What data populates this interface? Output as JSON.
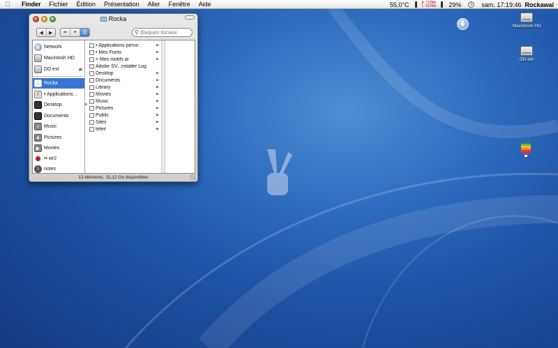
{
  "menubar": {
    "app": "Finder",
    "items": [
      "Fichier",
      "Édition",
      "Présentation",
      "Aller",
      "Fenêtre",
      "Aide"
    ],
    "temperature": "55,0°C",
    "memory_labels": [
      "8: 712Mo",
      "L: 312Mo"
    ],
    "battery": "29%",
    "clock": "sam. 17:19:46",
    "user": "Rockawai"
  },
  "window": {
    "title": "Rocka",
    "search_placeholder": "disques locaux",
    "status": "13 éléments, 15,12 Go disponibles"
  },
  "sidebar": {
    "devices": [
      {
        "label": "Network",
        "icon": "network-icon"
      },
      {
        "label": "Macintosh HD",
        "icon": "hard-disk-icon"
      },
      {
        "label": "DD ext",
        "icon": "external-disk-icon"
      }
    ],
    "places": [
      {
        "label": "Rocka",
        "icon": "home-icon",
        "selected": true
      },
      {
        "label": "• Applications…",
        "icon": "applications-icon"
      },
      {
        "label": "Desktop",
        "icon": "desktop-icon"
      },
      {
        "label": "Documents",
        "icon": "documents-icon"
      },
      {
        "label": "Music",
        "icon": "music-icon"
      },
      {
        "label": "Pictures",
        "icon": "pictures-icon"
      },
      {
        "label": "Movies",
        "icon": "movies-icon"
      },
      {
        "label": "•• wr2",
        "icon": "wr2-icon"
      },
      {
        "label": "notes",
        "icon": "notes-icon"
      }
    ]
  },
  "column": {
    "items": [
      {
        "label": "• Applications perso",
        "arrow": true
      },
      {
        "label": "• Mes Fonts",
        "arrow": true
      },
      {
        "label": "> Mes motifs ai",
        "arrow": true
      },
      {
        "label": "Adobe SV...nstaller Log",
        "arrow": false
      },
      {
        "label": "Desktop",
        "arrow": true
      },
      {
        "label": "Documents",
        "arrow": true
      },
      {
        "label": "Library",
        "arrow": true
      },
      {
        "label": "Movies",
        "arrow": true
      },
      {
        "label": "Music",
        "arrow": true
      },
      {
        "label": "Pictures",
        "arrow": true
      },
      {
        "label": "Public",
        "arrow": true
      },
      {
        "label": "Sites",
        "arrow": true
      },
      {
        "label": "teleir",
        "arrow": true
      }
    ]
  },
  "desktop": {
    "icons": [
      {
        "label": "Macintosh HD"
      },
      {
        "label": "DD ext"
      }
    ]
  },
  "colors": {
    "selection": "#3875d7",
    "wallpaper": "#1c4fa0"
  }
}
